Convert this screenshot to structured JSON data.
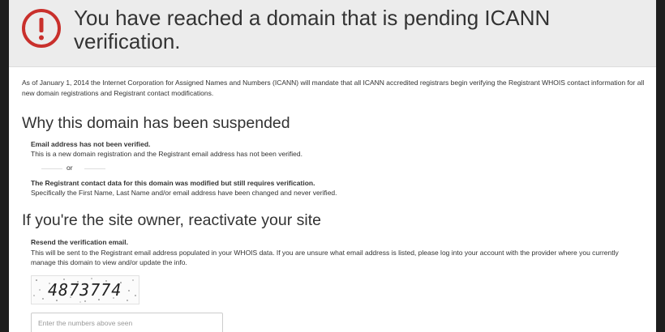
{
  "header": {
    "icon": "exclamation-circle-icon",
    "icon_color": "#c9302c",
    "title": "You have reached a domain that is pending ICANN verification."
  },
  "intro": "As of January 1, 2014 the Internet Corporation for Assigned Names and Numbers (ICANN) will mandate that all ICANN accredited registrars begin verifying the Registrant WHOIS contact information for all new domain registrations and Registrant contact modifications.",
  "why": {
    "heading": "Why this domain has been suspended",
    "reason1_title": "Email address has not been verified.",
    "reason1_text": "This is a new domain registration and the Registrant email address has not been verified.",
    "or": "or",
    "reason2_title": "The Registrant contact data for this domain was modified but still requires verification.",
    "reason2_text": "Specifically the First Name, Last Name and/or email address have been changed and never verified."
  },
  "owner": {
    "heading": "If you're the site owner, reactivate your site",
    "resend_title": "Resend the verification email.",
    "resend_text": "This will be sent to the Registrant email address populated in your WHOIS data. If you are unsure what email address is listed, please log into your account with the provider where you currently manage this domain to view and/or update the info.",
    "captcha_code": "4873774",
    "captcha_placeholder": "Enter the numbers above seen"
  }
}
